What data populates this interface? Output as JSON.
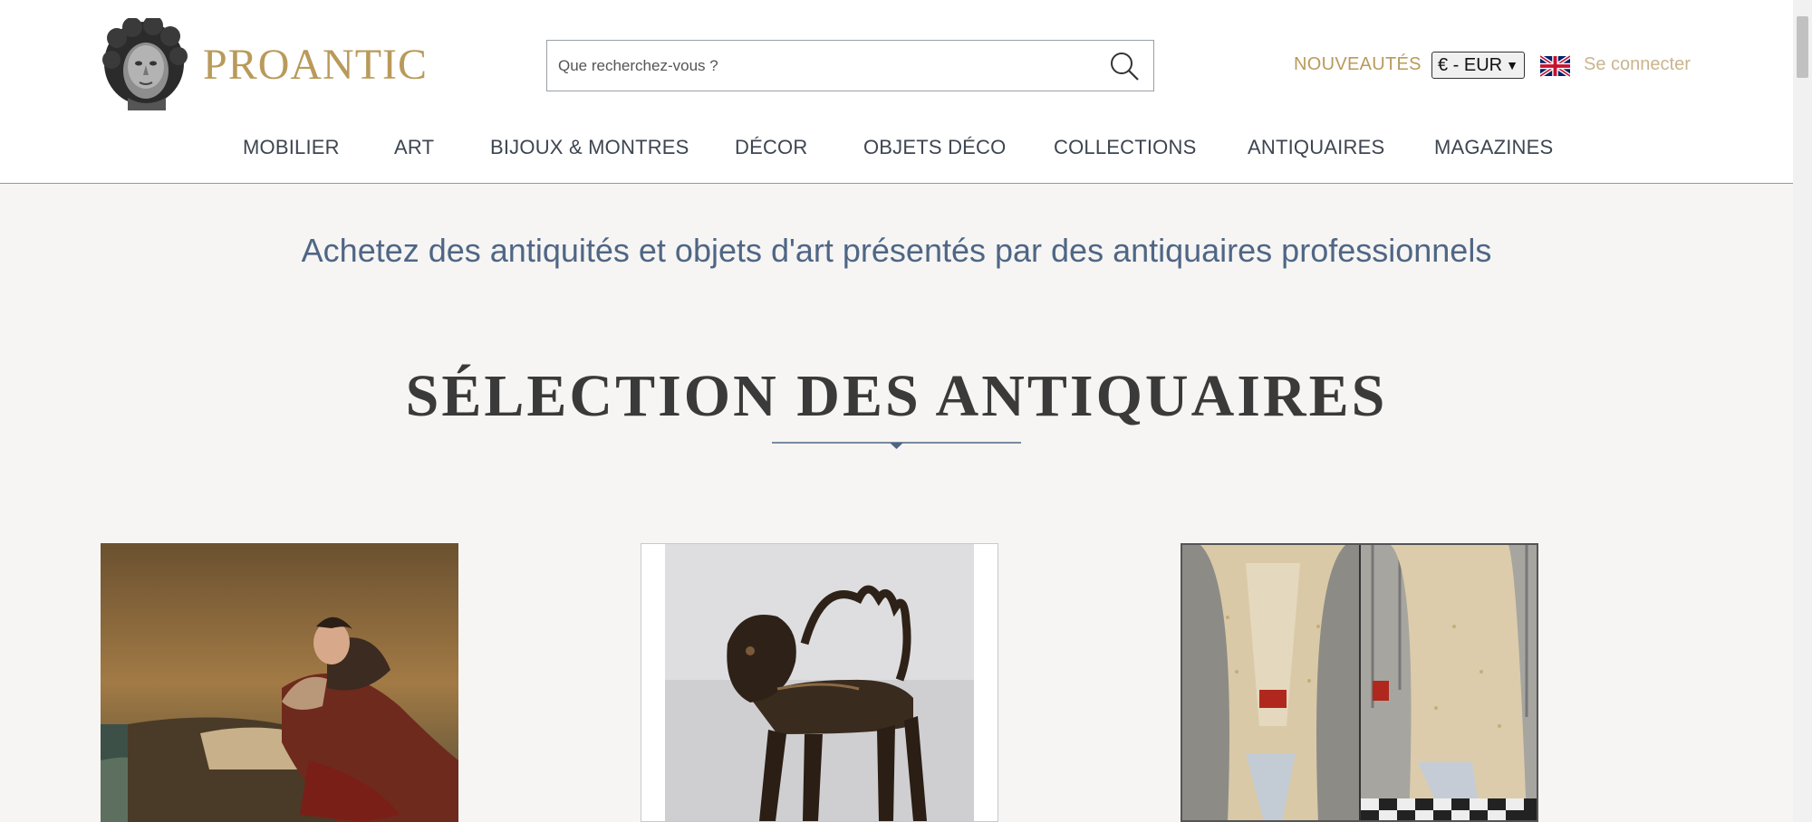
{
  "brand": {
    "name": "PROANTIC",
    "logo_icon": "classical-bust-logo"
  },
  "search": {
    "placeholder": "Que recherchez-vous ?",
    "value": "",
    "icon": "search-icon"
  },
  "header_links": {
    "nouveautes": "NOUVEAUTÉS",
    "currency_selected": "€ - EUR",
    "language_icon": "uk-flag-icon",
    "login": "Se connecter"
  },
  "nav": {
    "items": [
      {
        "label": "MOBILIER"
      },
      {
        "label": "ART"
      },
      {
        "label": "BIJOUX & MONTRES"
      },
      {
        "label": "DÉCOR"
      },
      {
        "label": "OBJETS DÉCO"
      },
      {
        "label": "COLLECTIONS"
      },
      {
        "label": "ANTIQUAIRES"
      },
      {
        "label": "MAGAZINES"
      }
    ]
  },
  "main": {
    "tagline": "Achetez des antiquités et objets d'art présentés par des antiquaires professionnels",
    "section_title": "SÉLECTION DES ANTIQUAIRES",
    "cards": [
      {
        "image": "painting-man-on-seaside-cliff"
      },
      {
        "image": "bronze-lion-aquamanile"
      },
      {
        "image": "embroidered-18th-century-waistcoat"
      }
    ]
  },
  "colors": {
    "brand_gold": "#b99a5a",
    "tagline_blue": "#4f6685",
    "background": "#f6f5f3"
  }
}
